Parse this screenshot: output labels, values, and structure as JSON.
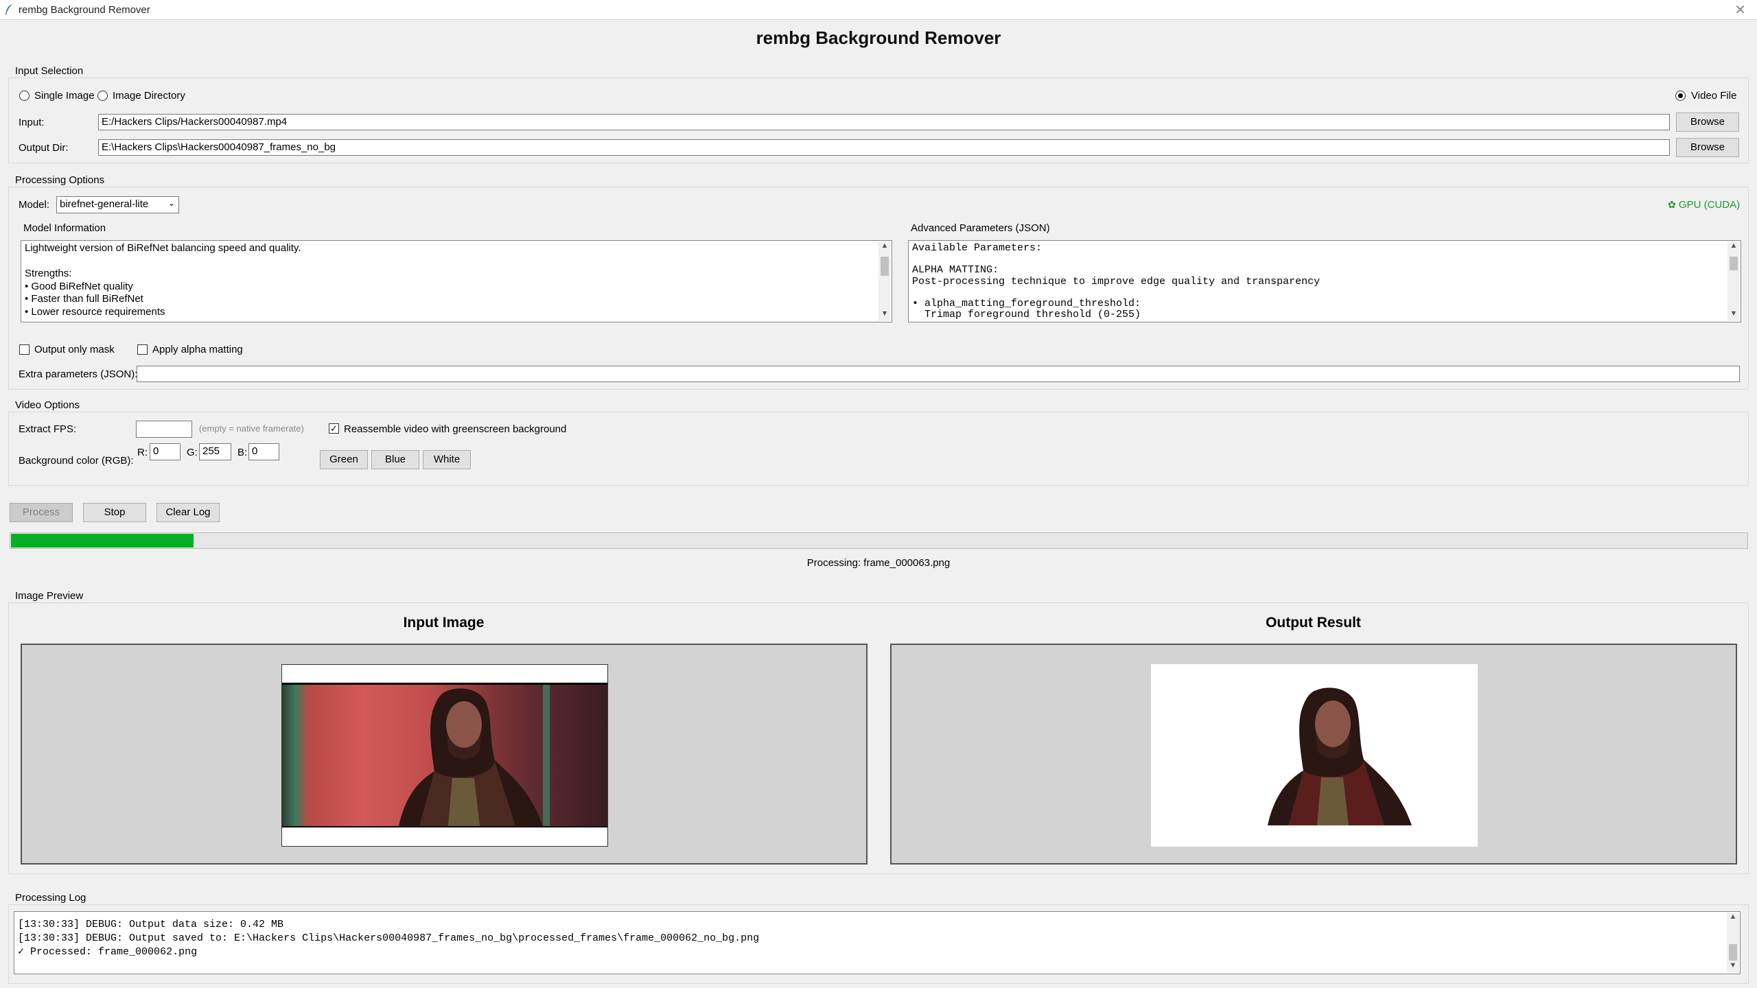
{
  "window": {
    "title": "rembg Background Remover",
    "close": "✕"
  },
  "app": {
    "title": "rembg Background Remover"
  },
  "input_selection": {
    "label": "Input Selection",
    "radio_single": "Single Image",
    "radio_directory": "Image Directory",
    "radio_video": "Video File",
    "input_label": "Input:",
    "input_value": "E:/Hackers Clips/Hackers00040987.mp4",
    "output_label": "Output Dir:",
    "output_value": "E:\\Hackers Clips\\Hackers00040987_frames_no_bg",
    "browse": "Browse"
  },
  "processing_options": {
    "label": "Processing Options",
    "model_label": "Model:",
    "model_value": "birefnet-general-lite",
    "gpu_status": "GPU (CUDA)",
    "model_info_label": "Model Information",
    "model_info_text": "Lightweight version of BiRefNet balancing speed and quality.\n\nStrengths:\n• Good BiRefNet quality\n• Faster than full BiRefNet\n• Lower resource requirements",
    "advanced_label": "Advanced Parameters (JSON)",
    "advanced_text": "Available Parameters:\n\nALPHA MATTING:\nPost-processing technique to improve edge quality and transparency\n\n• alpha_matting_foreground_threshold:\n  Trimap foreground threshold (0-255)",
    "output_only_mask": "Output only mask",
    "apply_alpha_matting": "Apply alpha matting",
    "extra_params_label": "Extra parameters (JSON):",
    "extra_params_value": ""
  },
  "video_options": {
    "label": "Video Options",
    "fps_label": "Extract FPS:",
    "fps_value": "",
    "fps_hint": "(empty = native framerate)",
    "reassemble": "Reassemble video with greenscreen background",
    "bg_label": "Background color (RGB):",
    "r_label": "R:",
    "r_value": "0",
    "g_label": "G:",
    "g_value": "255",
    "b_label": "B:",
    "b_value": "0",
    "green": "Green",
    "blue": "Blue",
    "white": "White"
  },
  "actions": {
    "process": "Process",
    "stop": "Stop",
    "clear_log": "Clear Log"
  },
  "progress": {
    "fraction": 0.105,
    "status": "Processing: frame_000063.png",
    "color": "#06b025"
  },
  "preview": {
    "label": "Image Preview",
    "input_title": "Input Image",
    "output_title": "Output Result"
  },
  "log": {
    "label": "Processing Log",
    "text": "[13:30:33] DEBUG: Output data size: 0.42 MB\n[13:30:33] DEBUG: Output saved to: E:\\Hackers Clips\\Hackers00040987_frames_no_bg\\processed_frames\\frame_000062_no_bg.png\n✓ Processed: frame_000062.png"
  }
}
